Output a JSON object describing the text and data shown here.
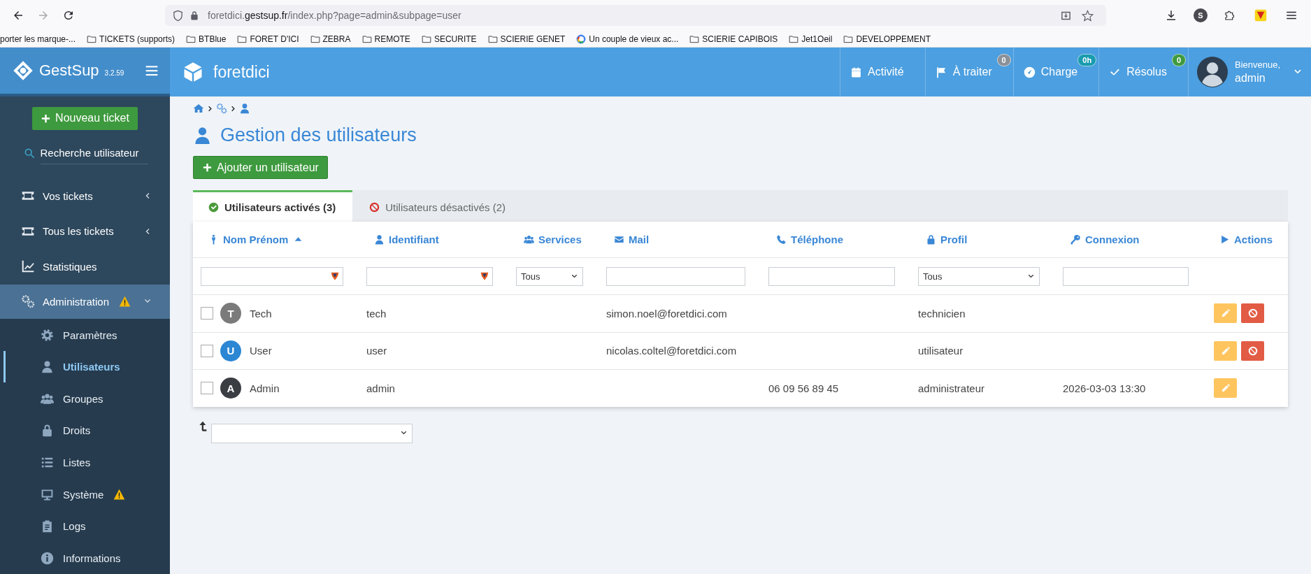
{
  "browser": {
    "url": {
      "subdomain": "foretdici.",
      "domain": "gestsup.fr",
      "path": "/index.php?page=admin&subpage=user"
    },
    "profile_initial": "S",
    "bookmarks": [
      {
        "label": "porter les marque-...",
        "kind": "plain"
      },
      {
        "label": "TICKETS (supports)",
        "kind": "folder"
      },
      {
        "label": "BTBlue",
        "kind": "folder"
      },
      {
        "label": "FORET D'ICI",
        "kind": "folder"
      },
      {
        "label": "ZEBRA",
        "kind": "folder"
      },
      {
        "label": "REMOTE",
        "kind": "folder"
      },
      {
        "label": "SECURITE",
        "kind": "folder"
      },
      {
        "label": "SCIERIE GENET",
        "kind": "folder"
      },
      {
        "label": "Un couple de vieux ac...",
        "kind": "site"
      },
      {
        "label": "SCIERIE CAPIBOIS",
        "kind": "folder"
      },
      {
        "label": "Jet1Oeil",
        "kind": "folder"
      },
      {
        "label": "DEVELOPPEMENT",
        "kind": "folder"
      }
    ]
  },
  "header": {
    "app_name": "GestSup",
    "version": "3.2.59",
    "company": "foretdici",
    "nav": [
      {
        "label": "Activité"
      },
      {
        "label": "À traiter",
        "badge": "0",
        "color": "#8a9199"
      },
      {
        "label": "Charge",
        "badge": "0h",
        "color": "#1a9bb0"
      },
      {
        "label": "Résolus",
        "badge": "0",
        "color": "#3f9a3f"
      }
    ],
    "user": {
      "greeting": "Bienvenue,",
      "name": "admin"
    }
  },
  "sidebar": {
    "new_ticket": "Nouveau ticket",
    "search_placeholder": "Recherche utilisateur",
    "items": [
      {
        "label": "Vos tickets",
        "kind": "menu",
        "expanded": false,
        "selected": false,
        "warning": false
      },
      {
        "label": "Tous les tickets",
        "kind": "menu",
        "expanded": false,
        "selected": false,
        "warning": false
      },
      {
        "label": "Statistiques",
        "kind": "link",
        "selected": false,
        "warning": false
      },
      {
        "label": "Administration",
        "kind": "menu",
        "expanded": true,
        "selected": true,
        "warning": true,
        "children": [
          {
            "label": "Paramètres",
            "selected": false,
            "warning": false
          },
          {
            "label": "Utilisateurs",
            "selected": true,
            "warning": false
          },
          {
            "label": "Groupes",
            "selected": false,
            "warning": false
          },
          {
            "label": "Droits",
            "selected": false,
            "warning": false
          },
          {
            "label": "Listes",
            "selected": false,
            "warning": false
          },
          {
            "label": "Système",
            "selected": false,
            "warning": true
          },
          {
            "label": "Logs",
            "selected": false,
            "warning": false
          },
          {
            "label": "Informations",
            "selected": false,
            "warning": false
          }
        ]
      }
    ]
  },
  "page": {
    "title": "Gestion des utilisateurs",
    "add_button": "Ajouter un utilisateur",
    "tabs": [
      {
        "label": "Utilisateurs activés (3)",
        "kind": "active",
        "selected": true
      },
      {
        "label": "Utilisateurs désactivés (2)",
        "kind": "disabled",
        "selected": false
      }
    ],
    "table": {
      "columns": [
        {
          "label": "Nom Prénom",
          "sorted": true
        },
        {
          "label": "Identifiant",
          "sorted": false
        },
        {
          "label": "Services",
          "sorted": false
        },
        {
          "label": "Mail",
          "sorted": false
        },
        {
          "label": "Téléphone",
          "sorted": false
        },
        {
          "label": "Profil",
          "sorted": false
        },
        {
          "label": "Connexion",
          "sorted": false
        },
        {
          "label": "Actions",
          "sorted": false
        }
      ],
      "filters": [
        {
          "kind": "text",
          "flag": true
        },
        {
          "kind": "text",
          "flag": true
        },
        {
          "kind": "select",
          "value": "Tous"
        },
        {
          "kind": "text",
          "flag": false
        },
        {
          "kind": "text",
          "flag": false
        },
        {
          "kind": "select",
          "value": "Tous"
        },
        {
          "kind": "text",
          "flag": false
        },
        {
          "kind": "none"
        }
      ],
      "rows": [
        {
          "checked": false,
          "initial": "T",
          "color": "#7b7b7b",
          "name": "Tech",
          "login": "tech",
          "mail": "simon.noel@foretdici.com",
          "profile": "technicien",
          "actions": [
            {
              "kind": "edit"
            },
            {
              "kind": "disable"
            }
          ]
        },
        {
          "checked": false,
          "initial": "U",
          "color": "#2b86d3",
          "name": "User",
          "login": "user",
          "mail": "nicolas.coltel@foretdici.com",
          "profile": "utilisateur",
          "actions": [
            {
              "kind": "edit"
            },
            {
              "kind": "disable"
            }
          ]
        },
        {
          "checked": false,
          "initial": "A",
          "color": "#3a3d42",
          "name": "Admin",
          "login": "admin",
          "phone": "06 09 56 89 45",
          "profile": "administrateur",
          "connexion": "2026-03-03 13:30",
          "actions": [
            {
              "kind": "edit"
            }
          ]
        }
      ]
    }
  }
}
